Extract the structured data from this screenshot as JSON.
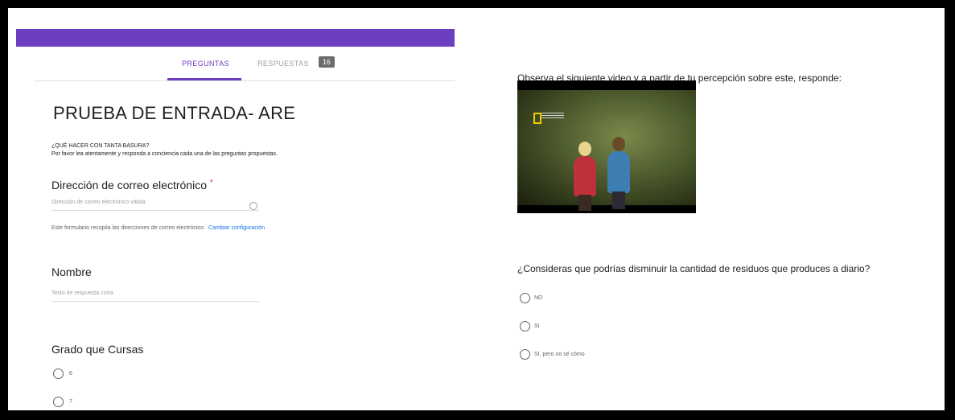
{
  "form": {
    "tabs": {
      "questions": "PREGUNTAS",
      "responses": "RESPUESTAS",
      "responses_count": "16"
    },
    "title": "PRUEBA DE ENTRADA- ARE",
    "description_line1": "¿QUÉ HACER CON TANTA BASURA?",
    "description_line2": "Por favor lea atentamente y responda a conciencia cada una de las preguntas propuestas.",
    "email": {
      "label": "Dirección de correo electrónico",
      "required_mark": "*",
      "placeholder": "Dirección de correo electrónico válida"
    },
    "email_notice": "Este formulario recopila las direcciones de correo electrónico.",
    "email_notice_link": "Cambiar configuración",
    "name": {
      "label": "Nombre",
      "placeholder": "Texto de respuesta corta"
    },
    "grade": {
      "label": "Grado que Cursas",
      "options": [
        "6",
        "7"
      ]
    }
  },
  "right": {
    "instruction": "Observa el siguiente video y a partir de tu percepción sobre este, responde:",
    "question": "¿Consideras que podrías disminuir la cantidad de residuos que produces a diario?",
    "options": [
      "NO",
      "SI",
      "SI, pero no sé cómo"
    ]
  },
  "colors": {
    "accent": "#6c3fc1",
    "link": "#1a73e8",
    "required": "#d93025"
  }
}
